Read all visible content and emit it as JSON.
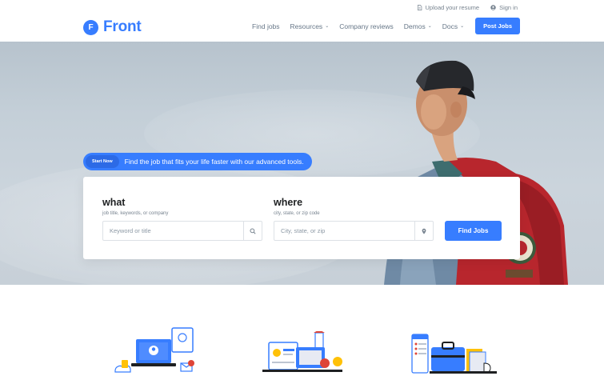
{
  "topbar": {
    "upload_label": "Upload your resume",
    "signin_label": "Sign in",
    "upload_icon": "document-icon",
    "signin_icon": "user-circle-icon"
  },
  "header": {
    "logo_letter": "F",
    "logo_text": "Front",
    "nav": [
      {
        "label": "Find jobs",
        "dropdown": false
      },
      {
        "label": "Resources",
        "dropdown": true
      },
      {
        "label": "Company reviews",
        "dropdown": false
      },
      {
        "label": "Demos",
        "dropdown": true
      },
      {
        "label": "Docs",
        "dropdown": true
      }
    ],
    "caret": "⌄",
    "post_jobs_label": "Post Jobs"
  },
  "hero": {
    "promo_badge": "Start Now",
    "promo_text": "Find the job that fits your life faster with our advanced tools.",
    "what_title": "what",
    "what_sub": "job title, keywords, or company",
    "what_placeholder": "Keyword or title",
    "where_title": "where",
    "where_sub": "city, state, or zip code",
    "where_placeholder": "City, state, or zip",
    "find_label": "Find Jobs"
  },
  "colors": {
    "primary": "#377dff",
    "text_dark": "#1e2022",
    "text_muted": "#677788"
  },
  "illustrations": [
    "laptop-profile-illustration",
    "resume-lighthouse-illustration",
    "briefcase-documents-illustration"
  ]
}
